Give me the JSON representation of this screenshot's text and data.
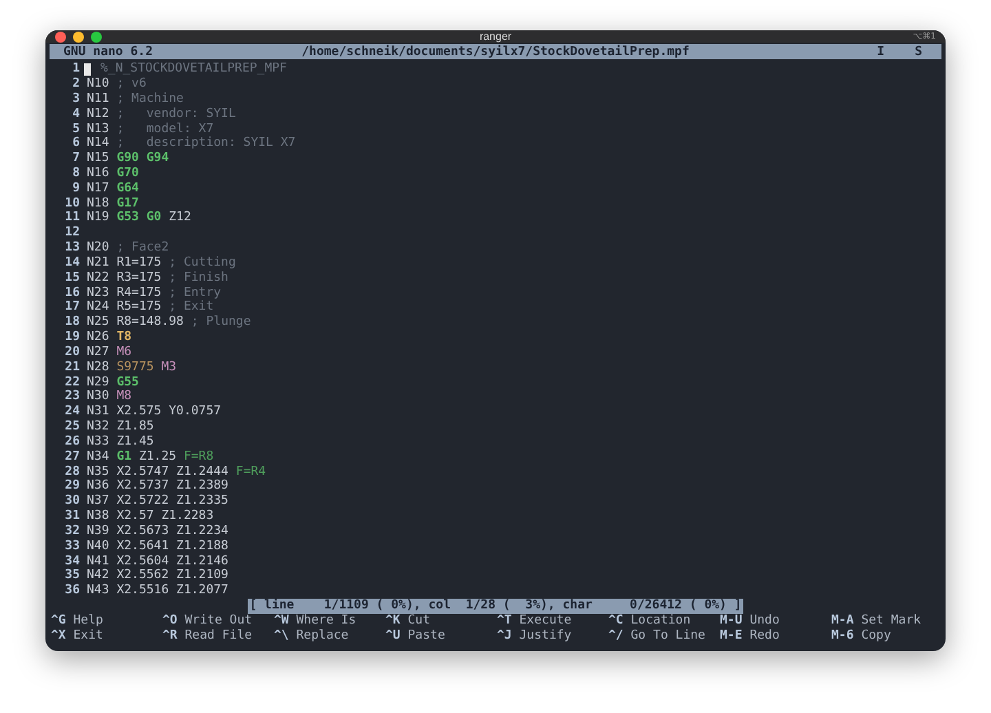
{
  "window": {
    "title": "ranger",
    "shortcut": "⌥⌘1"
  },
  "header": {
    "app": "GNU nano 6.2",
    "path": "/home/schneik/documents/syilx7/StockDovetailPrep.mpf",
    "flags": [
      "I",
      "S"
    ]
  },
  "lines": [
    {
      "num": "1",
      "cursor": true,
      "tokens": [
        {
          "text": "%_N_STOCKDOVETAILPREP_MPF",
          "kind": "comment"
        }
      ]
    },
    {
      "num": "2",
      "cursor": false,
      "tokens": [
        {
          "text": "N10",
          "kind": "plain"
        },
        {
          "text": "; v6",
          "kind": "comment"
        }
      ]
    },
    {
      "num": "3",
      "cursor": false,
      "tokens": [
        {
          "text": "N11",
          "kind": "plain"
        },
        {
          "text": "; Machine",
          "kind": "comment"
        }
      ]
    },
    {
      "num": "4",
      "cursor": false,
      "tokens": [
        {
          "text": "N12",
          "kind": "plain"
        },
        {
          "text": ";   vendor: SYIL",
          "kind": "comment"
        }
      ]
    },
    {
      "num": "5",
      "cursor": false,
      "tokens": [
        {
          "text": "N13",
          "kind": "plain"
        },
        {
          "text": ";   model: X7",
          "kind": "comment"
        }
      ]
    },
    {
      "num": "6",
      "cursor": false,
      "tokens": [
        {
          "text": "N14",
          "kind": "plain"
        },
        {
          "text": ";   description: SYIL X7",
          "kind": "comment"
        }
      ]
    },
    {
      "num": "7",
      "cursor": false,
      "tokens": [
        {
          "text": "N15",
          "kind": "plain"
        },
        {
          "text": "G90",
          "kind": "gcode"
        },
        {
          "text": "G94",
          "kind": "gcode"
        }
      ]
    },
    {
      "num": "8",
      "cursor": false,
      "tokens": [
        {
          "text": "N16",
          "kind": "plain"
        },
        {
          "text": "G70",
          "kind": "gcode"
        }
      ]
    },
    {
      "num": "9",
      "cursor": false,
      "tokens": [
        {
          "text": "N17",
          "kind": "plain"
        },
        {
          "text": "G64",
          "kind": "gcode"
        }
      ]
    },
    {
      "num": "10",
      "cursor": false,
      "tokens": [
        {
          "text": "N18",
          "kind": "plain"
        },
        {
          "text": "G17",
          "kind": "gcode"
        }
      ]
    },
    {
      "num": "11",
      "cursor": false,
      "tokens": [
        {
          "text": "N19",
          "kind": "plain"
        },
        {
          "text": "G53",
          "kind": "gcode"
        },
        {
          "text": "G0",
          "kind": "gcode"
        },
        {
          "text": "Z12",
          "kind": "plain"
        }
      ]
    },
    {
      "num": "12",
      "cursor": false
    },
    {
      "num": "13",
      "cursor": false,
      "tokens": [
        {
          "text": "N20",
          "kind": "plain"
        },
        {
          "text": "; Face2",
          "kind": "comment"
        }
      ]
    },
    {
      "num": "14",
      "cursor": false,
      "tokens": [
        {
          "text": "N21",
          "kind": "plain"
        },
        {
          "text": "R1=175",
          "kind": "plain"
        },
        {
          "text": "; Cutting",
          "kind": "comment"
        }
      ]
    },
    {
      "num": "15",
      "cursor": false,
      "tokens": [
        {
          "text": "N22",
          "kind": "plain"
        },
        {
          "text": "R3=175",
          "kind": "plain"
        },
        {
          "text": "; Finish",
          "kind": "comment"
        }
      ]
    },
    {
      "num": "16",
      "cursor": false,
      "tokens": [
        {
          "text": "N23",
          "kind": "plain"
        },
        {
          "text": "R4=175",
          "kind": "plain"
        },
        {
          "text": "; Entry",
          "kind": "comment"
        }
      ]
    },
    {
      "num": "17",
      "cursor": false,
      "tokens": [
        {
          "text": "N24",
          "kind": "plain"
        },
        {
          "text": "R5=175",
          "kind": "plain"
        },
        {
          "text": "; Exit",
          "kind": "comment"
        }
      ]
    },
    {
      "num": "18",
      "cursor": false,
      "tokens": [
        {
          "text": "N25",
          "kind": "plain"
        },
        {
          "text": "R8=148.98",
          "kind": "plain"
        },
        {
          "text": "; Plunge",
          "kind": "comment"
        }
      ]
    },
    {
      "num": "19",
      "cursor": false,
      "tokens": [
        {
          "text": "N26",
          "kind": "plain"
        },
        {
          "text": "T8",
          "kind": "tool"
        }
      ]
    },
    {
      "num": "20",
      "cursor": false,
      "tokens": [
        {
          "text": "N27",
          "kind": "plain"
        },
        {
          "text": "M6",
          "kind": "mcode"
        }
      ]
    },
    {
      "num": "21",
      "cursor": false,
      "tokens": [
        {
          "text": "N28",
          "kind": "plain"
        },
        {
          "text": "S9775",
          "kind": "spindle"
        },
        {
          "text": "M3",
          "kind": "mcode"
        }
      ]
    },
    {
      "num": "22",
      "cursor": false,
      "tokens": [
        {
          "text": "N29",
          "kind": "plain"
        },
        {
          "text": "G55",
          "kind": "gcode"
        }
      ]
    },
    {
      "num": "23",
      "cursor": false,
      "tokens": [
        {
          "text": "N30",
          "kind": "plain"
        },
        {
          "text": "M8",
          "kind": "mcode"
        }
      ]
    },
    {
      "num": "24",
      "cursor": false,
      "tokens": [
        {
          "text": "N31",
          "kind": "plain"
        },
        {
          "text": "X2.575",
          "kind": "plain"
        },
        {
          "text": "Y0.0757",
          "kind": "plain"
        }
      ]
    },
    {
      "num": "25",
      "cursor": false,
      "tokens": [
        {
          "text": "N32",
          "kind": "plain"
        },
        {
          "text": "Z1.85",
          "kind": "plain"
        }
      ]
    },
    {
      "num": "26",
      "cursor": false,
      "tokens": [
        {
          "text": "N33",
          "kind": "plain"
        },
        {
          "text": "Z1.45",
          "kind": "plain"
        }
      ]
    },
    {
      "num": "27",
      "cursor": false,
      "tokens": [
        {
          "text": "N34",
          "kind": "plain"
        },
        {
          "text": "G1",
          "kind": "gcode"
        },
        {
          "text": "Z1.25",
          "kind": "plain"
        },
        {
          "text": "F=R8",
          "kind": "feed"
        }
      ]
    },
    {
      "num": "28",
      "cursor": false,
      "tokens": [
        {
          "text": "N35",
          "kind": "plain"
        },
        {
          "text": "X2.5747",
          "kind": "plain"
        },
        {
          "text": "Z1.2444",
          "kind": "plain"
        },
        {
          "text": "F=R4",
          "kind": "feed"
        }
      ]
    },
    {
      "num": "29",
      "cursor": false,
      "tokens": [
        {
          "text": "N36",
          "kind": "plain"
        },
        {
          "text": "X2.5737",
          "kind": "plain"
        },
        {
          "text": "Z1.2389",
          "kind": "plain"
        }
      ]
    },
    {
      "num": "30",
      "cursor": false,
      "tokens": [
        {
          "text": "N37",
          "kind": "plain"
        },
        {
          "text": "X2.5722",
          "kind": "plain"
        },
        {
          "text": "Z1.2335",
          "kind": "plain"
        }
      ]
    },
    {
      "num": "31",
      "cursor": false,
      "tokens": [
        {
          "text": "N38",
          "kind": "plain"
        },
        {
          "text": "X2.57",
          "kind": "plain"
        },
        {
          "text": "Z1.2283",
          "kind": "plain"
        }
      ]
    },
    {
      "num": "32",
      "cursor": false,
      "tokens": [
        {
          "text": "N39",
          "kind": "plain"
        },
        {
          "text": "X2.5673",
          "kind": "plain"
        },
        {
          "text": "Z1.2234",
          "kind": "plain"
        }
      ]
    },
    {
      "num": "33",
      "cursor": false,
      "tokens": [
        {
          "text": "N40",
          "kind": "plain"
        },
        {
          "text": "X2.5641",
          "kind": "plain"
        },
        {
          "text": "Z1.2188",
          "kind": "plain"
        }
      ]
    },
    {
      "num": "34",
      "cursor": false,
      "tokens": [
        {
          "text": "N41",
          "kind": "plain"
        },
        {
          "text": "X2.5604",
          "kind": "plain"
        },
        {
          "text": "Z1.2146",
          "kind": "plain"
        }
      ]
    },
    {
      "num": "35",
      "cursor": false,
      "tokens": [
        {
          "text": "N42",
          "kind": "plain"
        },
        {
          "text": "X2.5562",
          "kind": "plain"
        },
        {
          "text": "Z1.2109",
          "kind": "plain"
        }
      ]
    },
    {
      "num": "36",
      "cursor": false,
      "tokens": [
        {
          "text": "N43",
          "kind": "plain"
        },
        {
          "text": "X2.5516",
          "kind": "plain"
        },
        {
          "text": "Z1.2077",
          "kind": "plain"
        }
      ]
    }
  ],
  "status": "[ line    1/1109 ( 0%), col  1/28 (  3%), char     0/26412 ( 0%) ]",
  "shortcuts": [
    {
      "key": "^G",
      "label": "Help"
    },
    {
      "key": "^O",
      "label": "Write Out"
    },
    {
      "key": "^W",
      "label": "Where Is"
    },
    {
      "key": "^K",
      "label": "Cut"
    },
    {
      "key": "^T",
      "label": "Execute"
    },
    {
      "key": "^C",
      "label": "Location"
    },
    {
      "key": "M-U",
      "label": "Undo"
    },
    {
      "key": "M-A",
      "label": "Set Mark"
    },
    {
      "key": "^X",
      "label": "Exit"
    },
    {
      "key": "^R",
      "label": "Read File"
    },
    {
      "key": "^\\",
      "label": "Replace"
    },
    {
      "key": "^U",
      "label": "Paste"
    },
    {
      "key": "^J",
      "label": "Justify"
    },
    {
      "key": "^/",
      "label": "Go To Line"
    },
    {
      "key": "M-E",
      "label": "Redo"
    },
    {
      "key": "M-6",
      "label": "Copy"
    }
  ]
}
